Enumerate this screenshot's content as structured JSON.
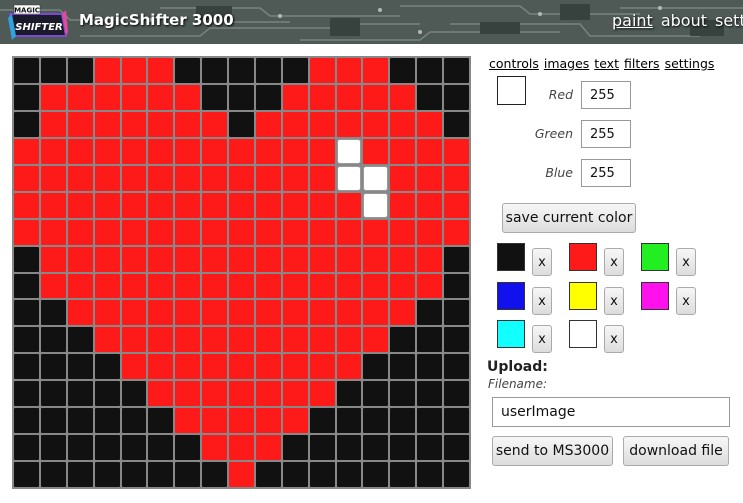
{
  "header": {
    "logo_top": "MAGIC",
    "logo_main": "SHIFTER",
    "title": "MagicShifter 3000",
    "nav": [
      "paint",
      "about",
      "settings"
    ]
  },
  "grid": {
    "rows": [
      "kkkrrrkkkkkrrrkkk",
      "krrrrrrkkkrrrrrkk",
      "krrrrrrrkrrrrrrrk",
      "rrrrrrrrrrrrwrrrr",
      "rrrrrrrrrrrrwwrrr",
      "rrrrrrrrrrrrrwrrr",
      "rrrrrrrrrrrrrrrrr",
      "krrrrrrrrrrrrrrrk",
      "krrrrrrrrrrrrrrrk",
      "kkrrrrrrrrrrrrrkk",
      "kkkrrrrrrrrrrrkkk",
      "kkkkrrrrrrrrrkkkk",
      "kkkkkrrrrrrrkkkkk",
      "kkkkkkrrrrrkkkkkk",
      "kkkkkkkrrrkkkkkkk",
      "kkkkkkkkrkkkkkkkk"
    ]
  },
  "tabs": [
    "controls",
    "images",
    "text",
    "filters",
    "settings"
  ],
  "current_color": "#ffffff",
  "channels": {
    "red_label": "Red",
    "red_value": "255",
    "green_label": "Green",
    "green_value": "255",
    "blue_label": "Blue",
    "blue_value": "255"
  },
  "save_color_label": "save current color",
  "saved_colors": [
    "#111111",
    "#ff1a1a",
    "#22ee22",
    "#1111ee",
    "#ffff00",
    "#ff11ee",
    "#11ffff",
    "#ffffff"
  ],
  "remove_label": "x",
  "upload": {
    "title": "Upload:",
    "filename_label": "Filename:",
    "filename_value": "userImage",
    "send_label": "send to MS3000",
    "download_label": "download file"
  }
}
